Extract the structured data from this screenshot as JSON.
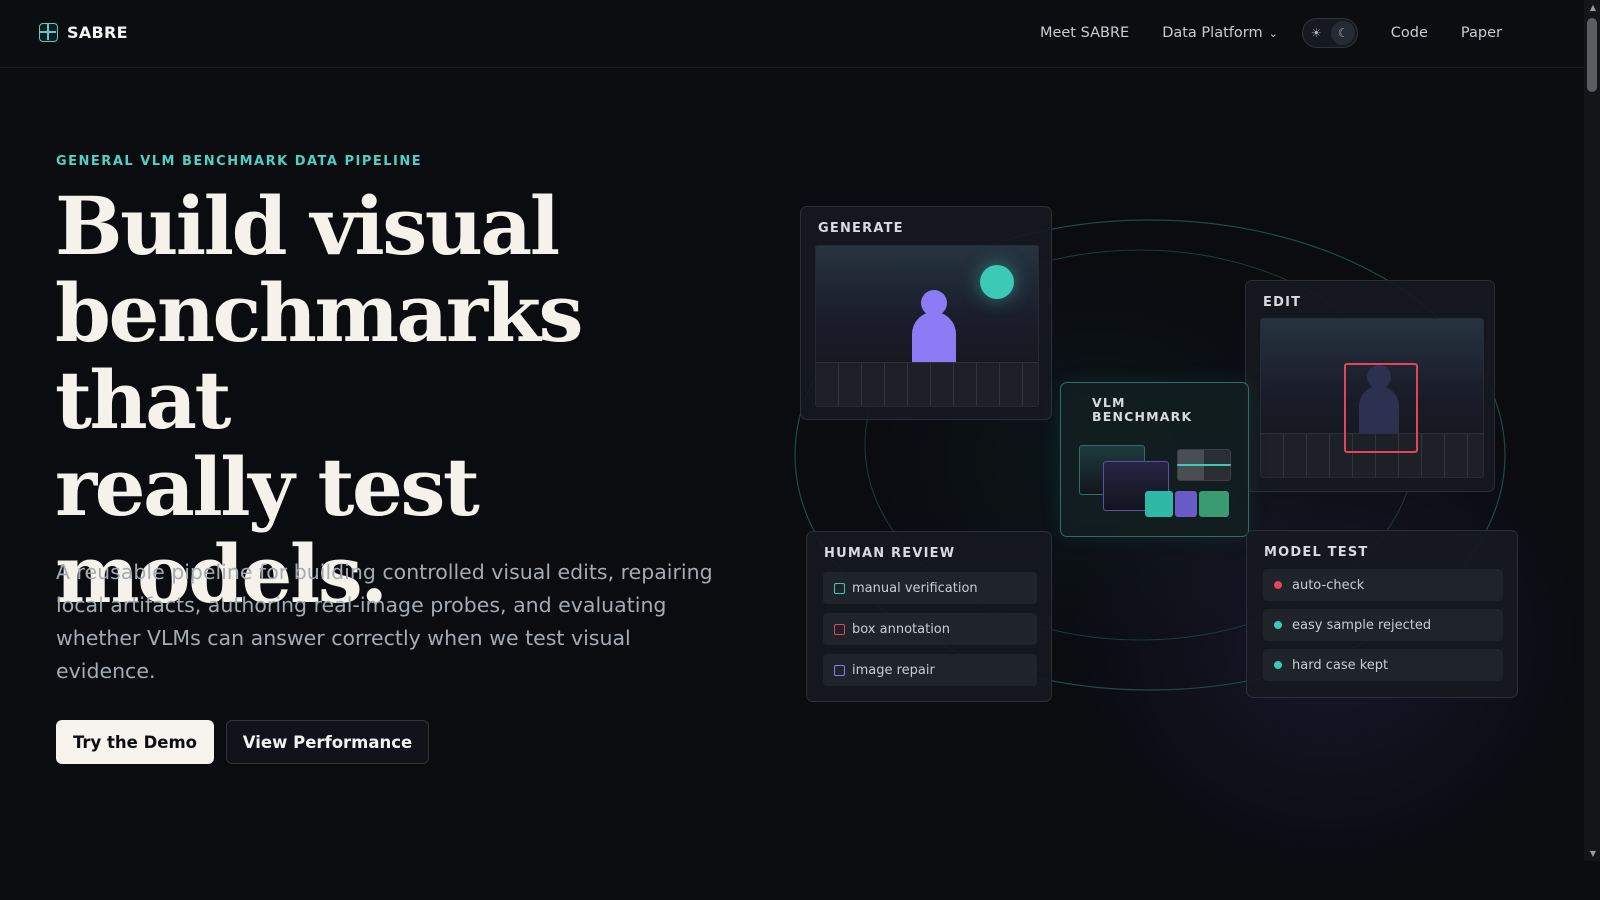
{
  "nav": {
    "brand": "SABRE",
    "links": [
      {
        "label": "Meet SABRE"
      },
      {
        "label": "Data Platform",
        "chevron": "⌄"
      },
      {
        "label": "Code"
      },
      {
        "label": "Paper"
      }
    ],
    "theme_toggle": {
      "light_icon": "☀",
      "dark_icon": "☾"
    }
  },
  "hero": {
    "eyebrow": "GENERAL VLM BENCHMARK DATA PIPELINE",
    "title_lines": [
      "Build visual",
      "benchmarks that",
      "really test",
      "models."
    ],
    "subtitle": "A reusable pipeline for building controlled visual edits, repairing local artifacts, authoring real-image probes, and evaluating whether VLMs can answer correctly when we test visual evidence.",
    "primary_cta": "Try the Demo",
    "secondary_cta": "View Performance"
  },
  "diagram": {
    "generate": {
      "title": "GENERATE"
    },
    "edit": {
      "title": "EDIT"
    },
    "vlm": {
      "title_line1": "VLM",
      "title_line2": "BENCHMARK"
    },
    "human_review": {
      "title": "HUMAN REVIEW",
      "items": [
        {
          "label": "manual verification",
          "color": "#3cc9b6"
        },
        {
          "label": "box annotation",
          "color": "#e0455a"
        },
        {
          "label": "image repair",
          "color": "#8b7cf6"
        }
      ]
    },
    "model_test": {
      "title": "MODEL TEST",
      "items": [
        {
          "label": "auto-check",
          "color": "#e0455a"
        },
        {
          "label": "easy sample rejected",
          "color": "#3cc9b6"
        },
        {
          "label": "hard case kept",
          "color": "#3cc9b6"
        }
      ]
    }
  },
  "colors": {
    "accent": "#4fd1c5",
    "purple": "#8b7cf6",
    "red": "#e0455a",
    "background": "#0a0c10"
  }
}
